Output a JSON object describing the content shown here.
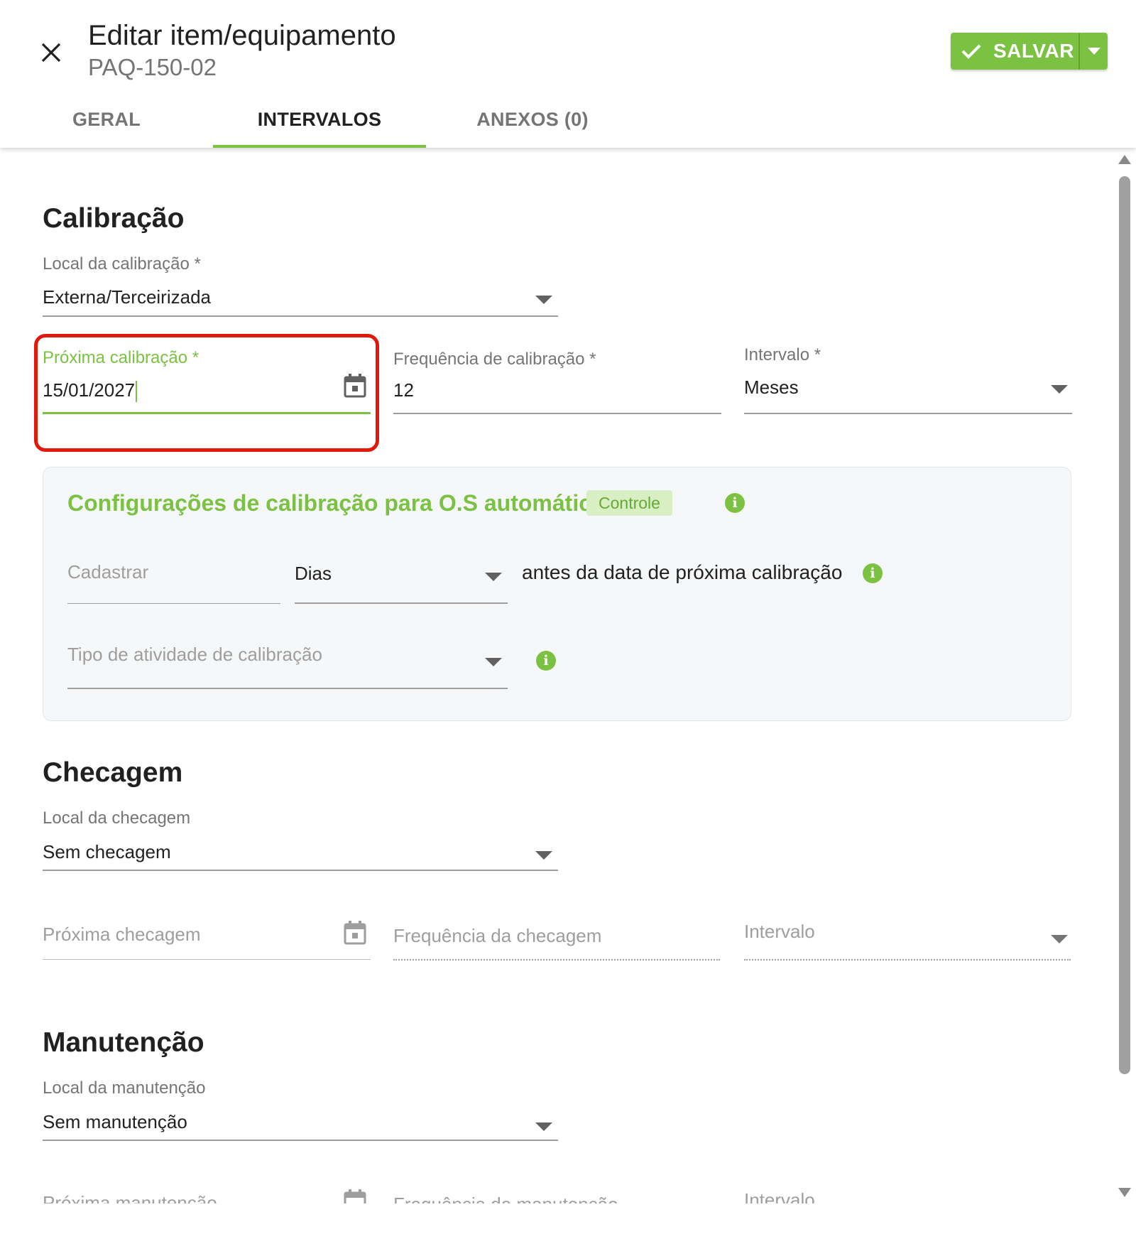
{
  "header": {
    "title": "Editar item/equipamento",
    "subtitle": "PAQ-150-02",
    "save_label": "SALVAR",
    "close_icon": "close-icon",
    "colors": {
      "accent": "#7cc242",
      "highlight": "#e0190b"
    }
  },
  "tabs": [
    {
      "label": "GERAL",
      "active": false
    },
    {
      "label": "INTERVALOS",
      "active": true
    },
    {
      "label": "ANEXOS (0)",
      "active": false
    }
  ],
  "calibracao": {
    "title": "Calibração",
    "local_label": "Local da calibração *",
    "local_value": "Externa/Terceirizada",
    "proxima_label": "Próxima calibração *",
    "proxima_value": "15/01/2027",
    "frequencia_label": "Frequência de calibração *",
    "frequencia_value": "12",
    "intervalo_label": "Intervalo *",
    "intervalo_value": "Meses"
  },
  "auto_os": {
    "title": "Configurações de calibração para O.S automática",
    "chip": "Controle",
    "cadastrar_placeholder": "Cadastrar",
    "unit_value": "Dias",
    "antes_text": "antes da data de próxima calibração",
    "tipo_placeholder": "Tipo de atividade de calibração"
  },
  "checagem": {
    "title": "Checagem",
    "local_label": "Local da checagem",
    "local_value": "Sem checagem",
    "proxima_placeholder": "Próxima checagem",
    "frequencia_placeholder": "Frequência da checagem",
    "intervalo_placeholder": "Intervalo"
  },
  "manutencao": {
    "title": "Manutenção",
    "local_label": "Local da manutenção",
    "local_value": "Sem manutenção",
    "proxima_placeholder": "Próxima manutenção",
    "frequencia_placeholder": "Frequência da manutenção",
    "intervalo_placeholder": "Intervalo"
  }
}
